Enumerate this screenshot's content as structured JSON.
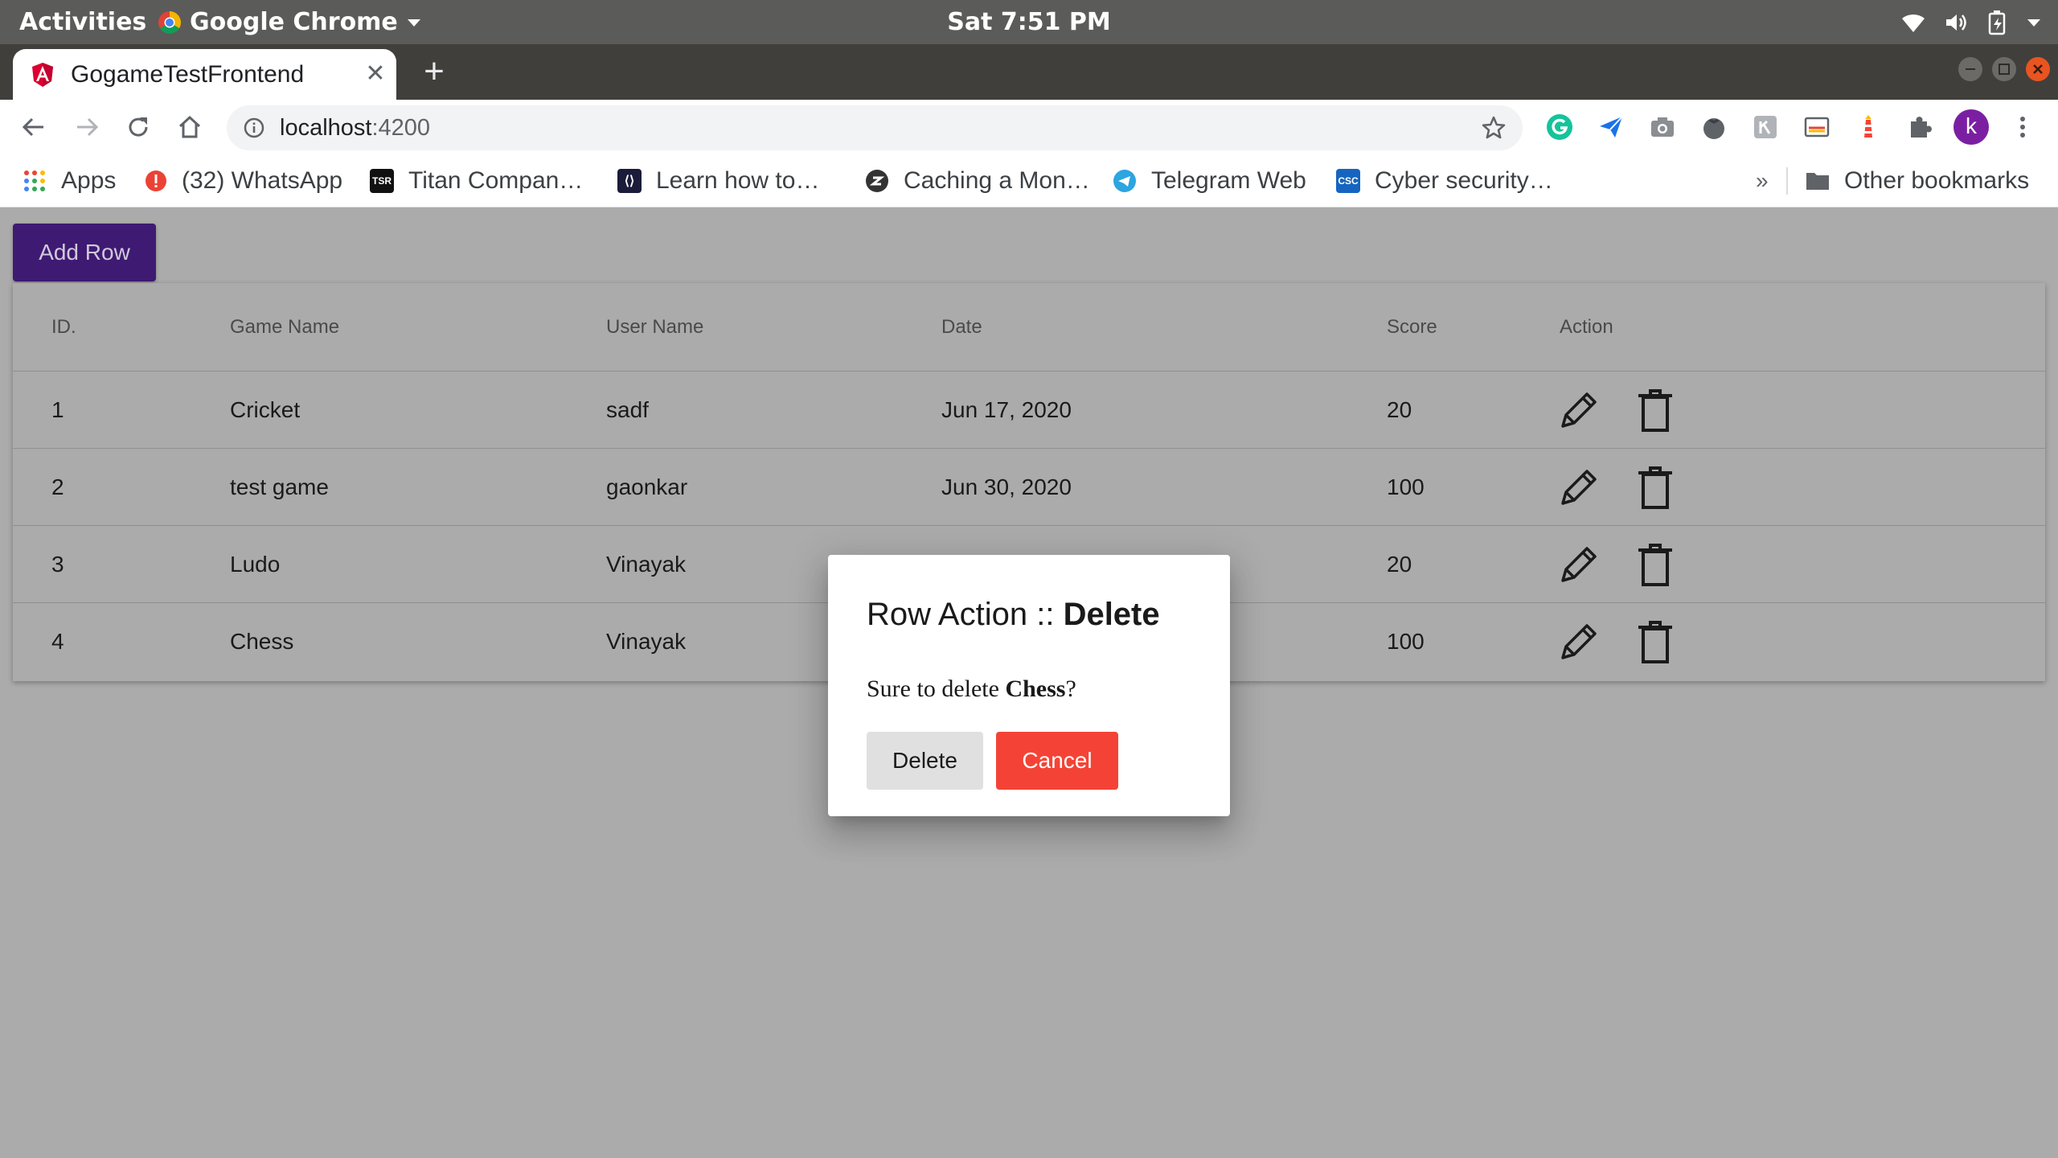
{
  "system": {
    "activities": "Activities",
    "app_name": "Google Chrome",
    "clock": "Sat  7:51 PM",
    "tray_icons": [
      "wifi-icon",
      "volume-icon",
      "battery-icon",
      "system-menu-icon"
    ]
  },
  "browser": {
    "tab_title": "GogameTestFrontend",
    "tab_close": "✕",
    "new_tab": "+",
    "url_host": "localhost",
    "url_port": ":4200",
    "profile_initial": "k",
    "extensions": [
      "grammarly-icon",
      "send-icon",
      "camera-icon",
      "tomato-icon",
      "ext-icon",
      "cast-icon",
      "lighthouse-icon",
      "puzzle-icon"
    ],
    "colors": {
      "tab_strip": "#403f3c",
      "profile": "#7b1fa2",
      "grammarly": "#15c39a"
    }
  },
  "bookmarks": {
    "items": [
      {
        "label": "Apps",
        "icon": "apps-grid-icon"
      },
      {
        "label": "(32) WhatsApp",
        "icon": "whatsapp-alert-icon"
      },
      {
        "label": "Titan Compan…",
        "icon": "tsr-icon"
      },
      {
        "label": "Learn how to…",
        "icon": "learn-icon"
      },
      {
        "label": "Caching a Mon…",
        "icon": "caching-icon"
      },
      {
        "label": "Telegram Web",
        "icon": "telegram-icon"
      },
      {
        "label": "Cyber security…",
        "icon": "csc-icon"
      }
    ],
    "overflow": "»",
    "other": "Other bookmarks"
  },
  "page": {
    "add_row_label": "Add Row",
    "columns": [
      "ID.",
      "Game Name",
      "User Name",
      "Date",
      "Score",
      "Action"
    ],
    "rows": [
      {
        "id": "1",
        "game": "Cricket",
        "user": "sadf",
        "date": "Jun 17, 2020",
        "score": "20"
      },
      {
        "id": "2",
        "game": "test game",
        "user": "gaonkar",
        "date": "Jun 30, 2020",
        "score": "100"
      },
      {
        "id": "3",
        "game": "Ludo",
        "user": "Vinayak",
        "date": "",
        "score": "20"
      },
      {
        "id": "4",
        "game": "Chess",
        "user": "Vinayak",
        "date": "",
        "score": "100"
      }
    ],
    "colors": {
      "add_row": "#3f1a73",
      "cancel": "#f44336",
      "overlay": "#ababab"
    }
  },
  "dialog": {
    "title_prefix": "Row Action :: ",
    "title_action": "Delete",
    "message_prefix": "Sure to delete ",
    "message_item": "Chess",
    "message_suffix": "?",
    "delete_label": "Delete",
    "cancel_label": "Cancel"
  }
}
